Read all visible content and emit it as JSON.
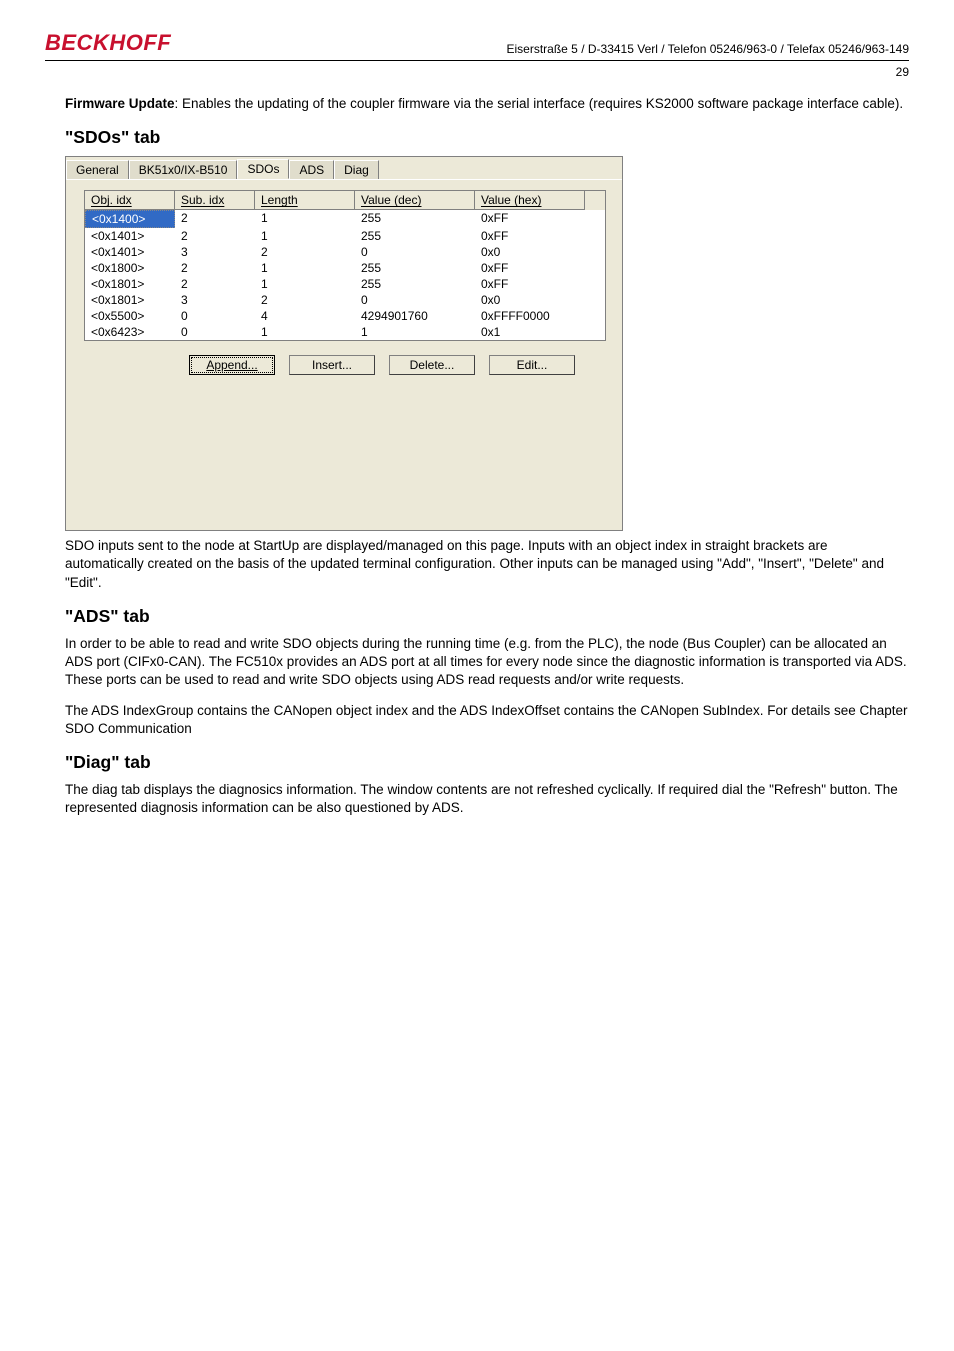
{
  "header": {
    "brand": "BECKHOFF",
    "address": "Eiserstraße 5 / D-33415 Verl / Telefon 05246/963-0 / Telefax 05246/963-149",
    "page_number": "29"
  },
  "intro": {
    "fw_label": "Firmware Update",
    "fw_text": ": Enables the updating of the coupler firmware via the serial interface (requires KS2000 software package interface cable)."
  },
  "sdos_section": {
    "heading": "\"SDOs\" tab",
    "after_text": "SDO inputs sent to the node at StartUp are displayed/managed on this page. Inputs with an object index in straight brackets are automatically created on the basis of the updated terminal configuration. Other inputs can be managed using \"Add\", \"Insert\", \"Delete\" and \"Edit\"."
  },
  "ads_section": {
    "heading": "\"ADS\" tab",
    "p1": "In order to be able to read and write SDO objects during the running time (e.g. from the PLC), the node (Bus Coupler) can be allocated an ADS port (CIFx0-CAN). The FC510x provides an ADS port at all times for every node since the diagnostic information is transported via ADS. These ports can be used to read and write SDO objects using ADS read requests and/or write requests.",
    "p2": "The ADS IndexGroup contains the CANopen object index and the ADS IndexOffset contains the CANopen SubIndex. For details see Chapter SDO Communication"
  },
  "diag_section": {
    "heading": "\"Diag\" tab",
    "p1": "The diag tab displays the diagnosics information. The window contents are not refreshed cyclically. If required dial the \"Refresh\" button. The represented diagnosis information can be also questioned by ADS."
  },
  "tabcontrol": {
    "tabs": [
      "General",
      "BK51x0/IX-B510",
      "SDOs",
      "ADS",
      "Diag"
    ],
    "active_index": 2,
    "columns": {
      "obj": "Obj. idx",
      "sub": "Sub. idx",
      "len": "Length",
      "dec": "Value (dec)",
      "hex": "Value (hex)"
    },
    "rows": [
      {
        "obj": "<0x1400>",
        "sub": "2",
        "len": "1",
        "dec": "255",
        "hex": "0xFF"
      },
      {
        "obj": "<0x1401>",
        "sub": "2",
        "len": "1",
        "dec": "255",
        "hex": "0xFF"
      },
      {
        "obj": "<0x1401>",
        "sub": "3",
        "len": "2",
        "dec": "0",
        "hex": "0x0"
      },
      {
        "obj": "<0x1800>",
        "sub": "2",
        "len": "1",
        "dec": "255",
        "hex": "0xFF"
      },
      {
        "obj": "<0x1801>",
        "sub": "2",
        "len": "1",
        "dec": "255",
        "hex": "0xFF"
      },
      {
        "obj": "<0x1801>",
        "sub": "3",
        "len": "2",
        "dec": "0",
        "hex": "0x0"
      },
      {
        "obj": "<0x5500>",
        "sub": "0",
        "len": "4",
        "dec": "4294901760",
        "hex": "0xFFFF0000"
      },
      {
        "obj": "<0x6423>",
        "sub": "0",
        "len": "1",
        "dec": "1",
        "hex": "0x1"
      }
    ],
    "selected_row": 0,
    "buttons": {
      "append": "Append...",
      "insert": "Insert...",
      "delete": "Delete...",
      "edit": "Edit..."
    }
  },
  "chart_data": {
    "type": "table",
    "title": "SDOs StartUp inputs",
    "columns": [
      "Obj. idx",
      "Sub. idx",
      "Length",
      "Value (dec)",
      "Value (hex)"
    ],
    "rows": [
      [
        "<0x1400>",
        2,
        1,
        255,
        "0xFF"
      ],
      [
        "<0x1401>",
        2,
        1,
        255,
        "0xFF"
      ],
      [
        "<0x1401>",
        3,
        2,
        0,
        "0x0"
      ],
      [
        "<0x1800>",
        2,
        1,
        255,
        "0xFF"
      ],
      [
        "<0x1801>",
        2,
        1,
        255,
        "0xFF"
      ],
      [
        "<0x1801>",
        3,
        2,
        0,
        "0x0"
      ],
      [
        "<0x5500>",
        0,
        4,
        4294901760,
        "0xFFFF0000"
      ],
      [
        "<0x6423>",
        0,
        1,
        1,
        "0x1"
      ]
    ]
  }
}
